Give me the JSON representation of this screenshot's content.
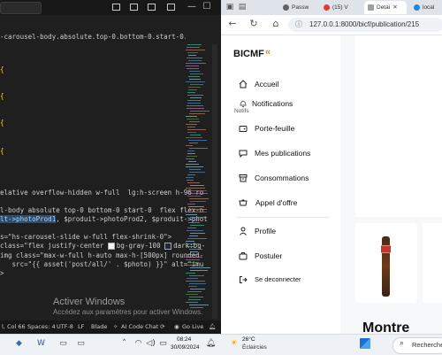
{
  "vscode": {
    "tab_path": "-carousel-body.absolute.top-0.bottom-0.start-0.flex.flex-nowrap.transition-transf...",
    "code_lines": [
      {
        "text": "elative overflow-hidden w-full  lg:h-screen h-96 ro"
      },
      {
        "text": "l-body absolute top-0 bottom-0 start-0  flex flex-n"
      },
      {
        "text": "lt->photoProd1",
        "rest": ", $produit->photoProd2, $produit->phot"
      },
      {
        "text": "s=\"hs-carousel-slide w-full flex-shrink-0\">"
      },
      {
        "text": "class=\"flex justify-center ",
        "rest": "bg-gray-100 ",
        "rest2": "dark:bg-"
      },
      {
        "text": "img class=\"max-w-full h-auto max-h-[500px] rounded-"
      },
      {
        "text": "   src=\"{{ asset('post/all/' . $photo) }}\" alt=\"imu"
      },
      {
        "text": ">"
      }
    ],
    "watermark_title": "Activer Windows",
    "watermark_sub": "Accédez aux paramètres pour activer Windows.",
    "status": {
      "position": "l, Col 66",
      "spaces": "Spaces: 4",
      "encoding": "UTF-8",
      "eol": "LF",
      "language": "Blade",
      "ai": "AI Code Chat",
      "golive": "Go Live"
    }
  },
  "browser": {
    "tabs": [
      {
        "label": "Passw",
        "color": "#5f6368"
      },
      {
        "label": "(15) V",
        "color": "#e53935"
      },
      {
        "label": "Detai",
        "color": "#9aa0a6"
      },
      {
        "label": "local",
        "color": "#1e88e5"
      }
    ],
    "url": "127.0.0.1:8000/bicf/publication/215",
    "brand": "BICMF",
    "brand_chevron": "«",
    "nav": [
      {
        "label": "Accueil",
        "icon": "home-icon"
      },
      {
        "label": "Notifications",
        "icon": "bell-icon"
      },
      {
        "label": "Porte-feuille",
        "icon": "wallet-icon"
      },
      {
        "label": "Mes publications",
        "icon": "chat-icon"
      },
      {
        "label": "Consommations",
        "icon": "archive-icon"
      },
      {
        "label": "Appel d'offre",
        "icon": "cart-icon"
      },
      {
        "label": "Profile",
        "icon": "user-icon"
      },
      {
        "label": "Postuler",
        "icon": "briefcase-icon"
      },
      {
        "label": "Se deconnecter",
        "icon": "logout-icon"
      }
    ],
    "notif_small": "Notifs",
    "section_title": "Montre"
  },
  "taskbar": {
    "time": "08:24",
    "date": "30/09/2024",
    "temp": "26°C",
    "weather": "Éclaircies",
    "search": "Rechercher"
  },
  "colors": {
    "accent": "#e08a1e",
    "editor_bg": "#1f1f1f",
    "selection": "#264f78"
  }
}
